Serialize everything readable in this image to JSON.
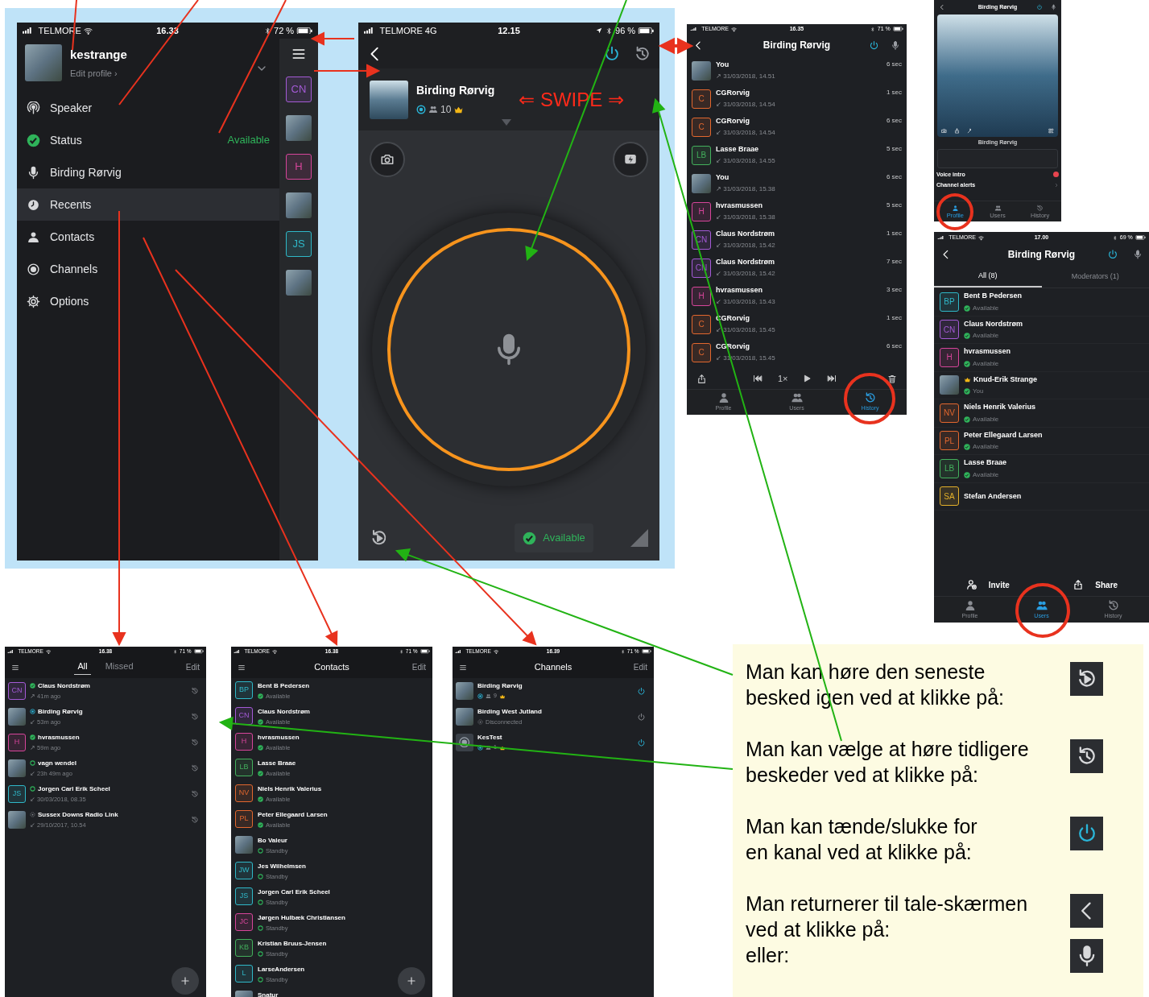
{
  "menu_phone": {
    "status_bar": {
      "carrier": "TELMORE",
      "time": "16.33",
      "battery": "72 %"
    },
    "profile": {
      "name": "kestrange",
      "link": "Edit profile ›"
    },
    "items": [
      {
        "label": "Speaker",
        "selected": false
      },
      {
        "label": "Status",
        "value": "Available",
        "selected": false
      },
      {
        "label": "Birding Rørvig",
        "selected": false
      },
      {
        "label": "Recents",
        "selected": true
      },
      {
        "label": "Contacts",
        "selected": false
      },
      {
        "label": "Channels",
        "selected": false
      },
      {
        "label": "Options",
        "selected": false
      }
    ],
    "side_avatars": [
      {
        "kind": "initials",
        "text": "CN",
        "color": "#a45ad6"
      },
      {
        "kind": "photo"
      },
      {
        "kind": "initials",
        "text": "H",
        "color": "#d6459a"
      },
      {
        "kind": "photo"
      },
      {
        "kind": "initials",
        "text": "JS",
        "color": "#2fb8c8"
      },
      {
        "kind": "photo"
      }
    ]
  },
  "talk_screen": {
    "status_bar": {
      "carrier": "TELMORE",
      "network": "4G",
      "time": "12.15",
      "battery": "96 %"
    },
    "channel": {
      "name": "Birding Rørvig",
      "count": "10"
    },
    "swipe": "⇐ SWIPE ⇒",
    "status": "Available"
  },
  "history_screen": {
    "status_bar": {
      "carrier": "TELMORE",
      "time": "16.35",
      "battery": "71 %"
    },
    "title": "Birding Rørvig",
    "rows": [
      {
        "avatar": {
          "kind": "photo"
        },
        "name": "You",
        "meta": "↗ 31/03/2018, 14.51",
        "duration": "6 sec"
      },
      {
        "avatar": {
          "kind": "initials",
          "text": "C",
          "color": "#e2672e"
        },
        "name": "CGRorvig",
        "meta": "↙ 31/03/2018, 14.54",
        "duration": "1 sec"
      },
      {
        "avatar": {
          "kind": "initials",
          "text": "C",
          "color": "#e2672e"
        },
        "name": "CGRorvig",
        "meta": "↙ 31/03/2018, 14.54",
        "duration": "6 sec"
      },
      {
        "avatar": {
          "kind": "initials",
          "text": "LB",
          "color": "#43b05c"
        },
        "name": "Lasse Braae",
        "meta": "↙ 31/03/2018, 14.55",
        "duration": "5 sec"
      },
      {
        "avatar": {
          "kind": "photo"
        },
        "name": "You",
        "meta": "↗ 31/03/2018, 15.38",
        "duration": "6 sec"
      },
      {
        "avatar": {
          "kind": "initials",
          "text": "H",
          "color": "#d6459a"
        },
        "name": "hvrasmussen",
        "meta": "↙ 31/03/2018, 15.38",
        "duration": "5 sec"
      },
      {
        "avatar": {
          "kind": "initials",
          "text": "CN",
          "color": "#a45ad6"
        },
        "name": "Claus Nordstrøm",
        "meta": "↙ 31/03/2018, 15.42",
        "duration": "1 sec"
      },
      {
        "avatar": {
          "kind": "initials",
          "text": "CN",
          "color": "#a45ad6"
        },
        "name": "Claus Nordstrøm",
        "meta": "↙ 31/03/2018, 15.42",
        "duration": "7 sec"
      },
      {
        "avatar": {
          "kind": "initials",
          "text": "H",
          "color": "#d6459a"
        },
        "name": "hvrasmussen",
        "meta": "↙ 31/03/2018, 15.43",
        "duration": "3 sec"
      },
      {
        "avatar": {
          "kind": "initials",
          "text": "C",
          "color": "#e2672e"
        },
        "name": "CGRorvig",
        "meta": "↙ 31/03/2018, 15.45",
        "duration": "1 sec"
      },
      {
        "avatar": {
          "kind": "initials",
          "text": "C",
          "color": "#e2672e"
        },
        "name": "CGRorvig",
        "meta": "↙ 31/03/2018, 15.45",
        "duration": "6 sec"
      }
    ],
    "speed": "1×",
    "tabs": [
      {
        "label": "Profile",
        "selected": false
      },
      {
        "label": "Users",
        "selected": false
      },
      {
        "label": "History",
        "selected": true
      }
    ]
  },
  "profile_screen": {
    "title": "Birding Rørvig",
    "caption": "Birding Rørvig",
    "voice_intro": "Voice intro",
    "channel_alerts": "Channel alerts",
    "tabs": [
      {
        "label": "Profile",
        "selected": true
      },
      {
        "label": "Users",
        "selected": false
      },
      {
        "label": "History",
        "selected": false
      }
    ]
  },
  "users_screen": {
    "status_bar": {
      "carrier": "TELMORE",
      "time": "17.00",
      "battery": "69 %"
    },
    "title": "Birding Rørvig",
    "filters": [
      {
        "label": "All (8)",
        "selected": true
      },
      {
        "label": "Moderators (1)",
        "selected": false
      }
    ],
    "rows": [
      {
        "avatar": {
          "kind": "initials",
          "text": "BP",
          "color": "#2fb8c8"
        },
        "name": "Bent B Pedersen",
        "crown": false,
        "status": "Available",
        "kind": "available"
      },
      {
        "avatar": {
          "kind": "initials",
          "text": "CN",
          "color": "#a45ad6"
        },
        "name": "Claus Nordstrøm",
        "crown": false,
        "status": "Available",
        "kind": "available"
      },
      {
        "avatar": {
          "kind": "initials",
          "text": "H",
          "color": "#d6459a"
        },
        "name": "hvrasmussen",
        "crown": false,
        "status": "Available",
        "kind": "available"
      },
      {
        "avatar": {
          "kind": "photo"
        },
        "name": "Knud-Erik Strange",
        "crown": true,
        "status": "You",
        "kind": "available"
      },
      {
        "avatar": {
          "kind": "initials",
          "text": "NV",
          "color": "#e2672e"
        },
        "name": "Niels Henrik Valerius",
        "crown": false,
        "status": "Available",
        "kind": "available"
      },
      {
        "avatar": {
          "kind": "initials",
          "text": "PL",
          "color": "#e2672e"
        },
        "name": "Peter Ellegaard Larsen",
        "crown": false,
        "status": "Available",
        "kind": "available"
      },
      {
        "avatar": {
          "kind": "initials",
          "text": "LB",
          "color": "#43b05c"
        },
        "name": "Lasse Braae",
        "crown": false,
        "status": "Available",
        "kind": "available"
      },
      {
        "avatar": {
          "kind": "initials",
          "text": "SA",
          "color": "#e3b02a"
        },
        "name": "Stefan Andersen",
        "crown": false
      }
    ],
    "actions": [
      {
        "label": "Invite"
      },
      {
        "label": "Share"
      }
    ],
    "tabs": [
      {
        "label": "Profile",
        "selected": false
      },
      {
        "label": "Users",
        "selected": true
      },
      {
        "label": "History",
        "selected": false
      }
    ]
  },
  "recents_screen": {
    "status_bar": {
      "carrier": "TELMORE",
      "time": "16.38",
      "battery": "71 %"
    },
    "tabs": [
      {
        "label": "All",
        "selected": true
      },
      {
        "label": "Missed",
        "selected": false
      }
    ],
    "edit": "Edit",
    "rows": [
      {
        "avatar": {
          "kind": "initials",
          "text": "CN",
          "color": "#a45ad6"
        },
        "kind": "available",
        "name": "Claus Nordstrøm",
        "meta": "↗ 41m ago"
      },
      {
        "avatar": {
          "kind": "photo"
        },
        "kind": "channel",
        "name": "Birding Rørvig",
        "meta": "↙ 53m ago"
      },
      {
        "avatar": {
          "kind": "initials",
          "text": "H",
          "color": "#d6459a"
        },
        "kind": "available",
        "name": "hvrasmussen",
        "meta": "↗ 59m ago"
      },
      {
        "avatar": {
          "kind": "photo"
        },
        "kind": "standby",
        "name": "vagn wendel",
        "meta": "↙ 23h 49m ago"
      },
      {
        "avatar": {
          "kind": "initials",
          "text": "JS",
          "color": "#2fb8c8"
        },
        "kind": "standby",
        "name": "Jorgen Carl Erik Scheel",
        "meta": "↙ 30/03/2018, 08.35"
      },
      {
        "avatar": {
          "kind": "photo"
        },
        "kind": "disconnected",
        "name": "Sussex Downs Radio Link",
        "meta": "↙ 29/10/2017, 10.54"
      }
    ]
  },
  "contacts_screen": {
    "status_bar": {
      "carrier": "TELMORE",
      "time": "16.38",
      "battery": "71 %"
    },
    "title": "Contacts",
    "edit": "Edit",
    "rows": [
      {
        "avatar": {
          "kind": "initials",
          "text": "BP",
          "color": "#2fb8c8"
        },
        "name": "Bent B Pedersen",
        "status": "Available",
        "kind": "available"
      },
      {
        "avatar": {
          "kind": "initials",
          "text": "CN",
          "color": "#a45ad6"
        },
        "name": "Claus Nordstrøm",
        "status": "Available",
        "kind": "available"
      },
      {
        "avatar": {
          "kind": "initials",
          "text": "H",
          "color": "#d6459a"
        },
        "name": "hvrasmussen",
        "status": "Available",
        "kind": "available"
      },
      {
        "avatar": {
          "kind": "initials",
          "text": "LB",
          "color": "#43b05c"
        },
        "name": "Lasse Braae",
        "status": "Available",
        "kind": "available"
      },
      {
        "avatar": {
          "kind": "initials",
          "text": "NV",
          "color": "#e2672e"
        },
        "name": "Niels Henrik Valerius",
        "status": "Available",
        "kind": "available"
      },
      {
        "avatar": {
          "kind": "initials",
          "text": "PL",
          "color": "#e2672e"
        },
        "name": "Peter Ellegaard Larsen",
        "status": "Available",
        "kind": "available"
      },
      {
        "avatar": {
          "kind": "photo"
        },
        "name": "Bo Valeur",
        "status": "Standby",
        "kind": "standby"
      },
      {
        "avatar": {
          "kind": "initials",
          "text": "JW",
          "color": "#2fb8c8"
        },
        "name": "Jes Wilhelmsen",
        "status": "Standby",
        "kind": "standby"
      },
      {
        "avatar": {
          "kind": "initials",
          "text": "JS",
          "color": "#2fb8c8"
        },
        "name": "Jorgen Carl Erik Scheel",
        "status": "Standby",
        "kind": "standby"
      },
      {
        "avatar": {
          "kind": "initials",
          "text": "JC",
          "color": "#d6459a"
        },
        "name": "Jørgen Hulbæk Christiansen",
        "status": "Standby",
        "kind": "standby"
      },
      {
        "avatar": {
          "kind": "initials",
          "text": "KB",
          "color": "#43b05c"
        },
        "name": "Kristian Bruus-Jensen",
        "status": "Standby",
        "kind": "standby"
      },
      {
        "avatar": {
          "kind": "initials",
          "text": "L",
          "color": "#2fb8c8"
        },
        "name": "LarseAndersen",
        "status": "Standby",
        "kind": "standby"
      },
      {
        "avatar": {
          "kind": "photo"
        },
        "name": "Snatur"
      }
    ]
  },
  "channels_screen": {
    "status_bar": {
      "carrier": "TELMORE",
      "time": "16.39",
      "battery": "71 %"
    },
    "title": "Channels",
    "edit": "Edit",
    "rows": [
      {
        "avatar": {
          "kind": "photo"
        },
        "name": "Birding Rørvig",
        "kind": "channel",
        "count": "9",
        "crown": true,
        "power": true
      },
      {
        "avatar": {
          "kind": "photo"
        },
        "name": "Birding West Jutland",
        "kind": "disconnected",
        "status": "Disconnected",
        "crown": false,
        "power": false
      },
      {
        "avatar": {
          "kind": "logo"
        },
        "name": "KesTest",
        "kind": "channel",
        "count": "1",
        "crown": true,
        "power": true
      }
    ]
  },
  "note": [
    {
      "text": "Man kan høre den seneste\nbesked igen ved at klikke på:"
    },
    {
      "text": "Man kan vælge at høre tidligere\nbeskeder ved at klikke på:"
    },
    {
      "text": "Man kan tænde/slukke for\nen kanal ved at klikke på:"
    },
    {
      "text": "Man returnerer til tale-skærmen\nved at klikke på:\neller:"
    }
  ]
}
